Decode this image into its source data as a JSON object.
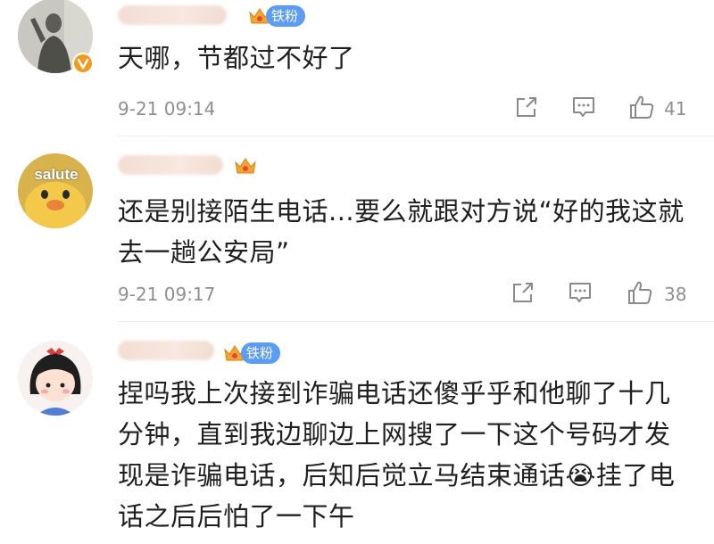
{
  "comments": [
    {
      "text": "天哪，节都过不好了",
      "time": "9-21 09:14",
      "likes": "41",
      "badge": "铁粉"
    },
    {
      "avatar_text": "salute",
      "text": "还是别接陌生电话...要么就跟对方说“好的我这就去一趟公安局”",
      "time": "9-21 09:17",
      "likes": "38"
    },
    {
      "text": "捏吗我上次接到诈骗电话还傻乎乎和他聊了十几分钟，直到我边聊边上网搜了一下这个号码才发现是诈骗电话，后知后觉立马结束通话😭挂了电话之后后怕了一下午",
      "badge": "铁粉"
    }
  ],
  "icons": {
    "share": "share-icon",
    "comment": "comment-icon",
    "like": "thumbs-up-icon",
    "verified": "verified-badge-icon",
    "level": "crown-level-icon"
  },
  "colors": {
    "badge_blue": "#5b9cf4",
    "verified_orange": "#f39a1c",
    "meta_gray": "#8f8f8f"
  }
}
